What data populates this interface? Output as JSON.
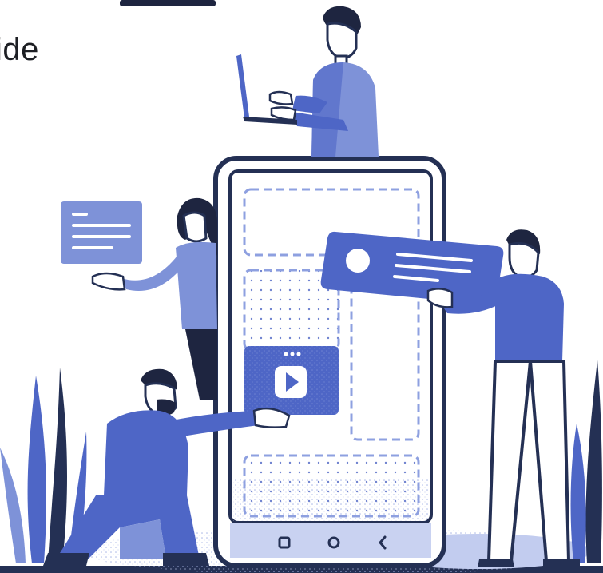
{
  "heading": {
    "text": "ide"
  },
  "phone": {
    "nav_buttons": [
      "square-nav-icon",
      "circle-nav-icon",
      "back-nav-icon"
    ]
  },
  "colors": {
    "primary": "#4e66c6",
    "mid": "#7e92d8",
    "light": "#b9c4ec",
    "navy": "#1e2540",
    "outline": "#243054",
    "white": "#ffffff"
  }
}
